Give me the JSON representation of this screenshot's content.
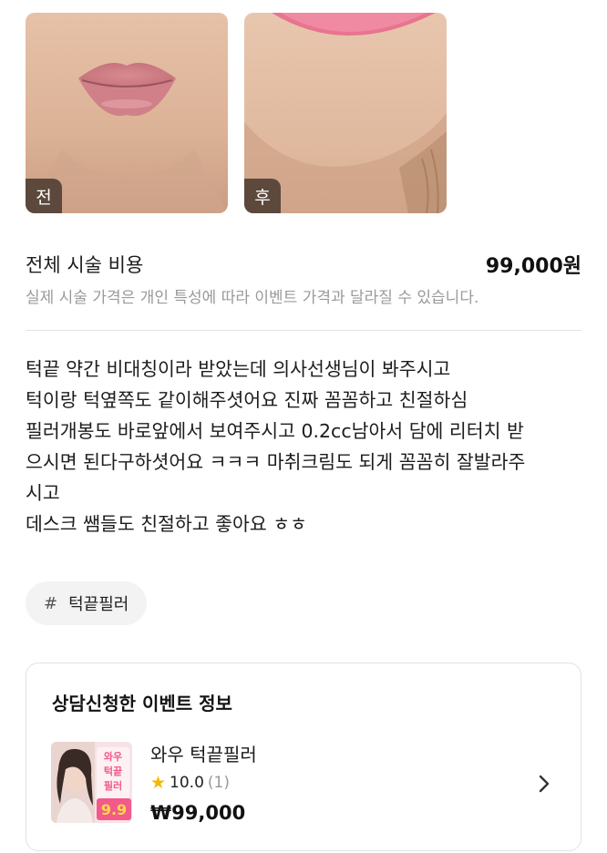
{
  "photos": {
    "before_label": "전",
    "after_label": "후"
  },
  "price": {
    "label": "전체 시술 비용",
    "value": "99,000원",
    "note": "실제 시술 가격은 개인 특성에 따라 이벤트 가격과 달라질 수 있습니다."
  },
  "review": {
    "lines": [
      "턱끝 약간 비대칭이라 받았는데 의사선생님이 봐주시고",
      "턱이랑 턱옆쪽도 같이해주셧어요 진짜 꼼꼼하고 친절하심",
      "필러개봉도 바로앞에서 보여주시고 0.2cc남아서 담에 리터치 받",
      "으시면 된다구하셧어요 ㅋㅋㅋ 마취크림도 되게 꼼꼼히 잘발라주",
      "시고",
      "데스크 쌤들도 친절하고 좋아요 ㅎㅎ"
    ]
  },
  "tag": {
    "hash": "#",
    "text": "턱끝필러"
  },
  "event": {
    "title": "상담신청한 이벤트 정보",
    "name": "와우 턱끝필러",
    "rating": "10.0",
    "rating_count": "(1)",
    "price": "₩99,000",
    "thumb_text": [
      "와우",
      "턱끝",
      "필러",
      "9.9"
    ]
  },
  "colors": {
    "star": "#f5b800",
    "thumb_pink": "#f25a8a",
    "thumb_yellow": "#ffd84a"
  }
}
